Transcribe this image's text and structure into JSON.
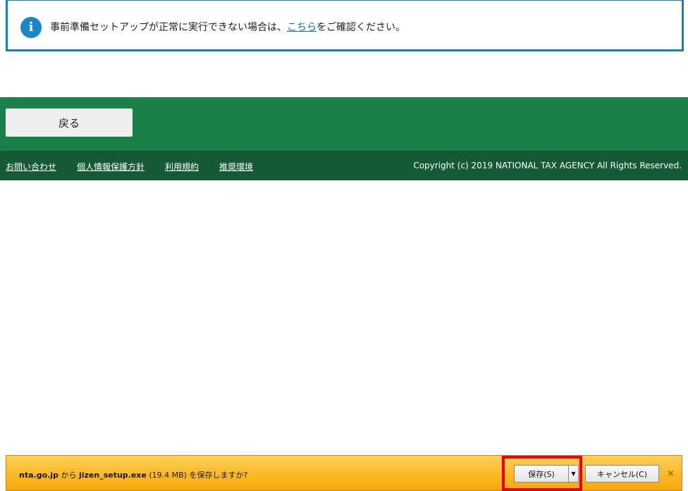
{
  "notice": {
    "icon": "info-icon",
    "icon_glyph": "i",
    "text_before": "事前準備セットアップが正常に実行できない場合は、",
    "link_text": "こちら",
    "text_after": "をご確認ください。"
  },
  "nav": {
    "back_label": "戻る"
  },
  "footer": {
    "links": [
      "お問い合わせ",
      "個人情報保護方針",
      "利用規約",
      "推奨環境"
    ],
    "copyright": "Copyright (c) 2019 NATIONAL TAX AGENCY All Rights Reserved."
  },
  "download_bar": {
    "site": "nta.go.jp",
    "from_text": " から ",
    "file_name": "jizen_setup.exe",
    "size_text": " (19.4 MB) ",
    "question": "を保存しますか?",
    "save_label": "保存(S)",
    "dropdown_glyph": "▼",
    "cancel_label": "キャンセル(C)",
    "close_glyph": "×"
  },
  "colors": {
    "accent_blue": "#1a7fb3",
    "green_band": "#1a8049",
    "footer_green": "#145a34",
    "download_bar": "#fbb722",
    "highlight_red": "#e8001c"
  }
}
